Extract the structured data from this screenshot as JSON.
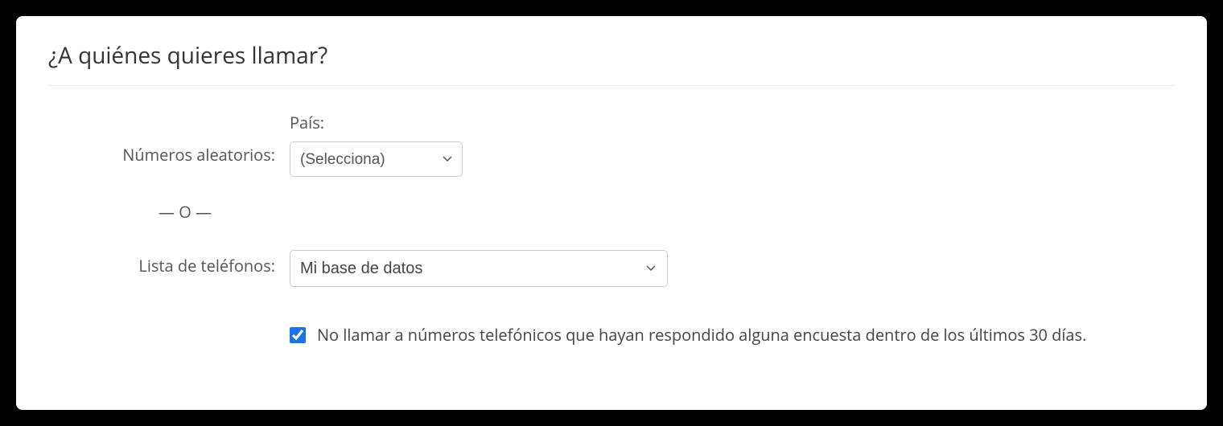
{
  "heading": "¿A quiénes quieres llamar?",
  "randomNumbers": {
    "label": "Números aleatorios:",
    "countryLabel": "País:",
    "countrySelect": "(Selecciona)"
  },
  "orSeparator": "— O —",
  "phoneList": {
    "label": "Lista de teléfonos:",
    "selected": "Mi base de datos"
  },
  "doNotCall": {
    "checked": true,
    "label": "No llamar a números telefónicos que hayan respondido alguna encuesta dentro de los últimos 30 días."
  }
}
